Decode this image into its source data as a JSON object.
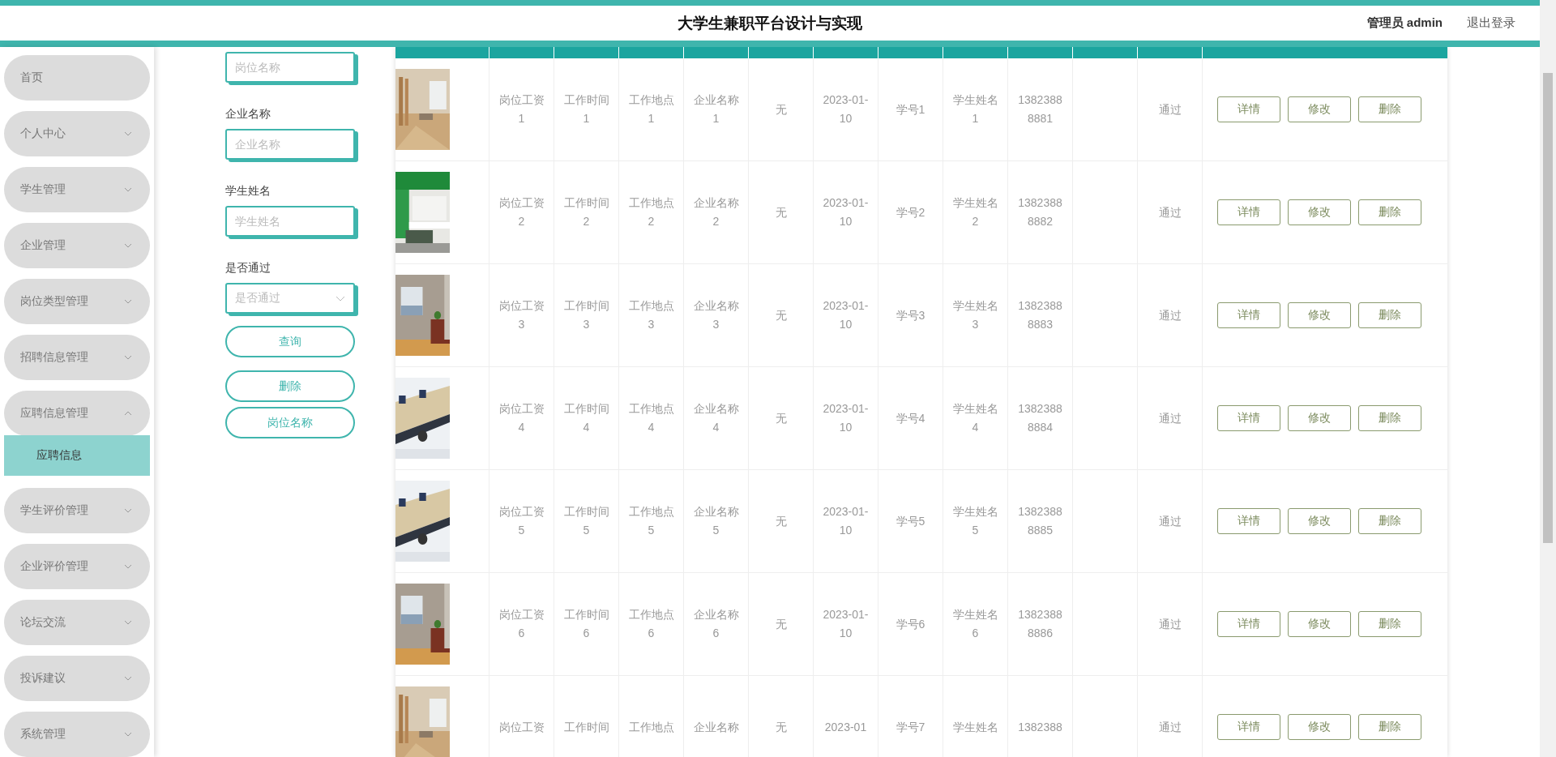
{
  "header": {
    "title": "大学生兼职平台设计与实现",
    "user": "管理员 admin",
    "logout": "退出登录"
  },
  "sidebar": {
    "items": [
      {
        "label": "首页",
        "kind": "link"
      },
      {
        "label": "个人中心",
        "kind": "submenu",
        "expanded": false
      },
      {
        "label": "学生管理",
        "kind": "submenu",
        "expanded": false
      },
      {
        "label": "企业管理",
        "kind": "submenu",
        "expanded": false
      },
      {
        "label": "岗位类型管理",
        "kind": "submenu",
        "expanded": false
      },
      {
        "label": "招聘信息管理",
        "kind": "submenu",
        "expanded": false
      },
      {
        "label": "应聘信息管理",
        "kind": "submenu",
        "expanded": true,
        "children": [
          {
            "label": "应聘信息",
            "selected": true
          }
        ]
      },
      {
        "label": "学生评价管理",
        "kind": "submenu",
        "expanded": false
      },
      {
        "label": "企业评价管理",
        "kind": "submenu",
        "expanded": false
      },
      {
        "label": "论坛交流",
        "kind": "submenu",
        "expanded": false
      },
      {
        "label": "投诉建议",
        "kind": "submenu",
        "expanded": false
      },
      {
        "label": "系统管理",
        "kind": "submenu",
        "expanded": false
      }
    ]
  },
  "filters": {
    "fields": [
      {
        "kind": "input",
        "placeholder": "岗位名称"
      },
      {
        "kind": "input",
        "label": "企业名称",
        "placeholder": "企业名称"
      },
      {
        "kind": "input",
        "label": "学生姓名",
        "placeholder": "学生姓名"
      },
      {
        "kind": "select",
        "label": "是否通过",
        "placeholder": "是否通过"
      }
    ],
    "buttons": [
      "查询",
      "删除",
      "岗位名称"
    ]
  },
  "table": {
    "rows": [
      {
        "photo": {
          "kind": "picture"
        },
        "cells": [
          "岗位工资1",
          "工作时间1",
          "工作地点1",
          "企业名称1",
          "无",
          "2023-01-10",
          "学号1",
          "学生姓名1",
          "13823888881",
          null,
          "通过"
        ],
        "actions": [
          "详情",
          "修改",
          "删除"
        ]
      },
      {
        "photo": {
          "kind": "picture"
        },
        "cells": [
          "岗位工资2",
          "工作时间2",
          "工作地点2",
          "企业名称2",
          "无",
          "2023-01-10",
          "学号2",
          "学生姓名2",
          "13823888882",
          null,
          "通过"
        ],
        "actions": [
          "详情",
          "修改",
          "删除"
        ]
      },
      {
        "photo": {
          "kind": "picture"
        },
        "cells": [
          "岗位工资3",
          "工作时间3",
          "工作地点3",
          "企业名称3",
          "无",
          "2023-01-10",
          "学号3",
          "学生姓名3",
          "13823888883",
          null,
          "通过"
        ],
        "actions": [
          "详情",
          "修改",
          "删除"
        ]
      },
      {
        "photo": {
          "kind": "picture"
        },
        "cells": [
          "岗位工资4",
          "工作时间4",
          "工作地点4",
          "企业名称4",
          "无",
          "2023-01-10",
          "学号4",
          "学生姓名4",
          "13823888884",
          null,
          "通过"
        ],
        "actions": [
          "详情",
          "修改",
          "删除"
        ]
      },
      {
        "photo": {
          "kind": "picture"
        },
        "cells": [
          "岗位工资5",
          "工作时间5",
          "工作地点5",
          "企业名称5",
          "无",
          "2023-01-10",
          "学号5",
          "学生姓名5",
          "13823888885",
          null,
          "通过"
        ],
        "actions": [
          "详情",
          "修改",
          "删除"
        ]
      },
      {
        "photo": {
          "kind": "picture"
        },
        "cells": [
          "岗位工资6",
          "工作时间6",
          "工作地点6",
          "企业名称6",
          "无",
          "2023-01-10",
          "学号6",
          "学生姓名6",
          "13823888886",
          null,
          "通过"
        ],
        "actions": [
          "详情",
          "修改",
          "删除"
        ]
      },
      {
        "photo": {
          "kind": "picture"
        },
        "cells": [
          "岗位工资",
          "工作时间",
          "工作地点",
          "企业名称",
          "无",
          "2023-01",
          "学号7",
          "学生姓名",
          "1382388",
          null,
          "通过"
        ],
        "actions": [
          "详情",
          "修改",
          "删除"
        ]
      }
    ]
  }
}
